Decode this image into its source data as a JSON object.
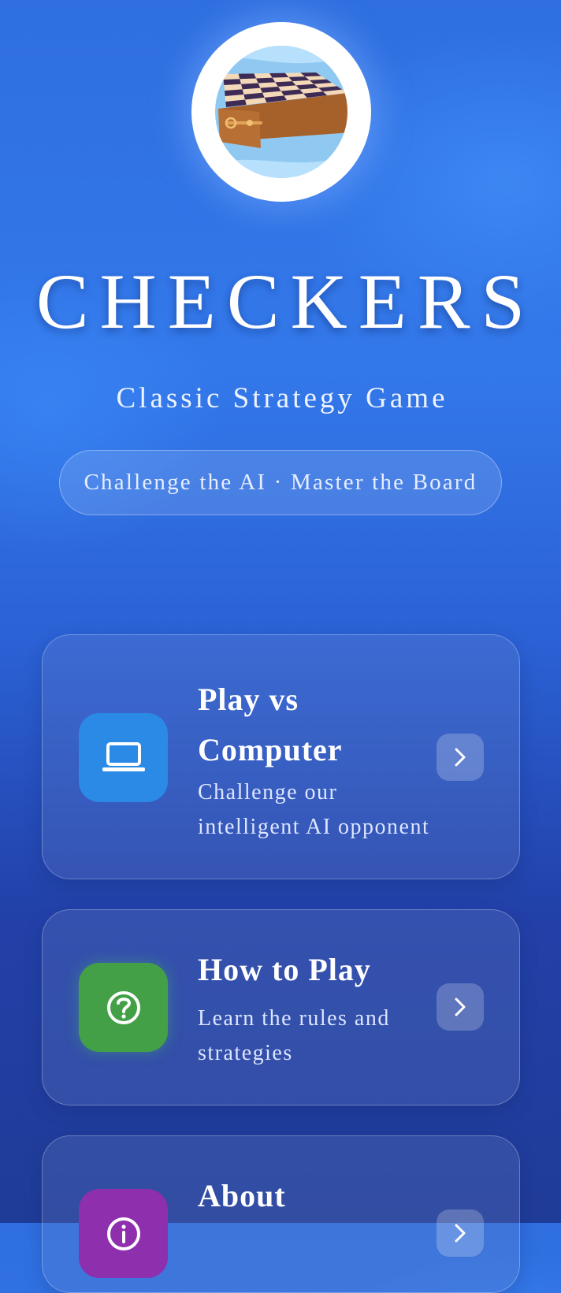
{
  "app": {
    "title": "CHECKERS",
    "subtitle": "Classic Strategy Game",
    "tagline": "Challenge the AI · Master the Board",
    "logo_icon": "checkerboard-logo-icon"
  },
  "menu": {
    "items": [
      {
        "title": "Play vs Computer",
        "description": "Challenge our intelligent AI opponent",
        "icon": "laptop-icon",
        "icon_color": "#2a8ae6"
      },
      {
        "title": "How to Play",
        "description": "Learn the rules and strategies",
        "icon": "help-circle-icon",
        "icon_color": "#43a047"
      },
      {
        "title": "About",
        "description": "",
        "icon": "info-icon",
        "icon_color": "#8e2fae"
      }
    ]
  },
  "colors": {
    "background_top": "#2f6fe0",
    "background_bottom": "#1f3c98"
  }
}
